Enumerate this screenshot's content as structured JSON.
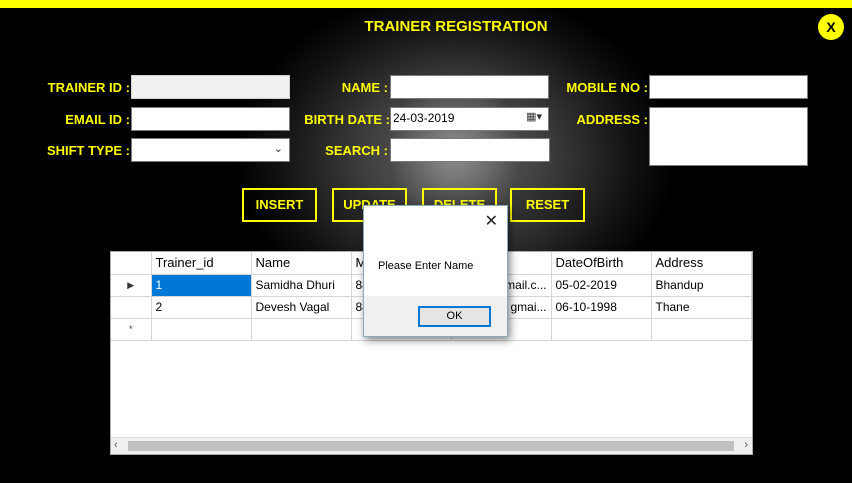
{
  "window": {
    "title": "TRAINER REGISTRATION",
    "close_label": "X"
  },
  "form": {
    "trainer_id": {
      "label": "TRAINER ID :",
      "value": ""
    },
    "name": {
      "label": "NAME :",
      "value": ""
    },
    "mobile_no": {
      "label": "MOBILE NO :",
      "value": ""
    },
    "email_id": {
      "label": "EMAIL ID :",
      "value": ""
    },
    "birth_date": {
      "label": "BIRTH DATE :",
      "value": "24-03-2019"
    },
    "address": {
      "label": "ADDRESS :",
      "value": ""
    },
    "shift_type": {
      "label": "SHIFT TYPE :",
      "value": ""
    },
    "search": {
      "label": "SEARCH :",
      "value": ""
    }
  },
  "buttons": {
    "insert": "INSERT",
    "update": "UPDATE",
    "delete": "DELETE",
    "reset": "RESET"
  },
  "grid": {
    "columns": [
      "Trainer_id",
      "Name",
      "M",
      "",
      "DateOfBirth",
      "Address"
    ],
    "rows": [
      {
        "indicator": "▶",
        "cells": [
          "1",
          "Samidha Dhuri",
          "88",
          "mail.c...",
          "05-02-2019",
          "Bhandup"
        ]
      },
      {
        "indicator": "",
        "cells": [
          "2",
          "Devesh Vagal",
          "88",
          "gmai...",
          "06-10-1998",
          "Thane"
        ]
      }
    ],
    "new_row_indicator": "*"
  },
  "dialog": {
    "message": "Please Enter Name",
    "ok_label": "OK",
    "close_label": "✕"
  },
  "colors": {
    "accent": "#ffff00",
    "background": "#000000",
    "selection": "#0078d7"
  }
}
